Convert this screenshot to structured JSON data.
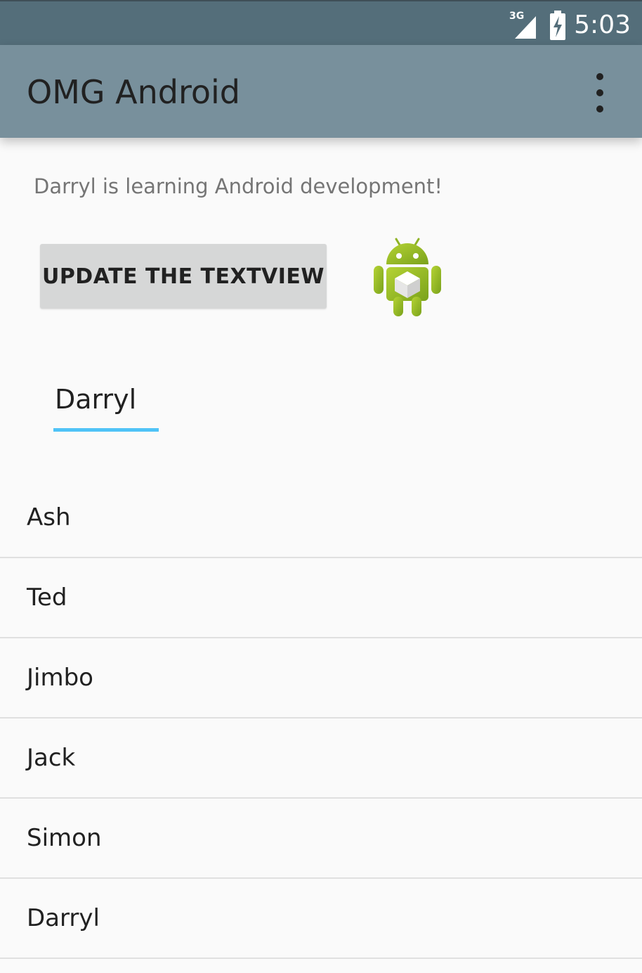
{
  "status_bar": {
    "network_label": "3G",
    "time": "5:03",
    "icons": [
      "network-signal-icon",
      "battery-charging-icon"
    ]
  },
  "app_bar": {
    "title": "OMG Android",
    "menu_icon": "overflow-menu-icon",
    "color": "#78909c"
  },
  "main": {
    "message": "Darryl is learning Android development!",
    "button_label": "UPDATE THE TEXTVIEW",
    "logo_icon": "android-robot-icon",
    "name_input_value": "Darryl",
    "accent_color": "#4fc3f7"
  },
  "list": {
    "items": [
      "Ash",
      "Ted",
      "Jimbo",
      "Jack",
      "Simon",
      "Darryl"
    ]
  }
}
